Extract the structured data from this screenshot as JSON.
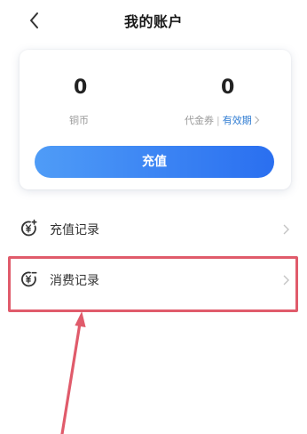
{
  "header": {
    "title": "我的账户",
    "back_icon": "chevron-left-icon"
  },
  "account": {
    "copper": {
      "value": "0",
      "label": "铜币"
    },
    "voucher": {
      "value": "0",
      "label": "代金券",
      "separator": "|",
      "validity_label": "有效期"
    },
    "recharge_button": "充值"
  },
  "records": [
    {
      "label": "充值记录",
      "icon": "yuan-coin-icon"
    },
    {
      "label": "消费记录",
      "icon": "yuan-coin-icon"
    }
  ],
  "annotation": {
    "highlight_color": "#e05b6b",
    "arrow_color": "#e05b6b"
  },
  "colors": {
    "accent_blue": "#2a6ff0",
    "link_blue": "#2d7bd2"
  }
}
